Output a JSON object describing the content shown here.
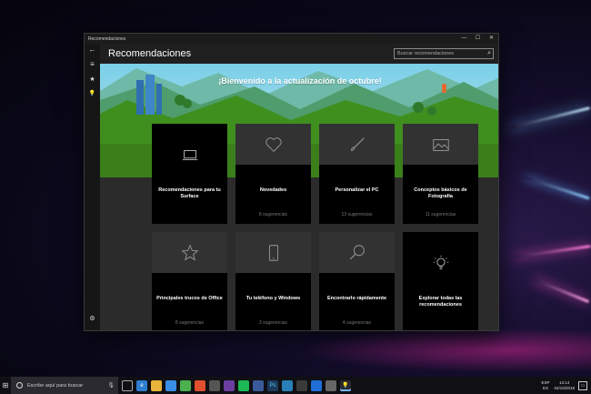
{
  "window": {
    "titlebar_title": "Recomendaciones",
    "controls": {
      "minimize": "—",
      "maximize": "☐",
      "close": "✕"
    }
  },
  "nav": {
    "back_icon": "←",
    "menu_icon": "≡",
    "favorites_icon": "★",
    "tips_icon": "💡",
    "settings_icon": "⚙"
  },
  "header": {
    "page_title": "Recomendaciones",
    "search_placeholder": "Buscar recomendaciones"
  },
  "banner": {
    "welcome_text": "¡Bienvenido a la actualización de octubre!"
  },
  "tiles": [
    {
      "title": "Recomendaciones para tu Surface",
      "count": "",
      "icon": "laptop-icon",
      "featured": true
    },
    {
      "title": "Novedades",
      "count": "8 sugerencias",
      "icon": "heart-icon"
    },
    {
      "title": "Personalizar el PC",
      "count": "13 sugerencias",
      "icon": "brush-icon"
    },
    {
      "title": "Conceptos básicos de Fotografía",
      "count": "11 sugerencias",
      "icon": "photo-icon"
    },
    {
      "title": "Principales trucos de Office",
      "count": "8 sugerencias",
      "icon": "star-icon"
    },
    {
      "title": "Tu teléfono y Windows",
      "count": "3 sugerencias",
      "icon": "phone-icon"
    },
    {
      "title": "Encontrarlo rápidamente",
      "count": "4 sugerencias",
      "icon": "search-icon"
    },
    {
      "title": "Explorar todas las recomendaciones",
      "count": "",
      "icon": "lightbulb-icon",
      "featured": true
    }
  ],
  "taskbar": {
    "search_placeholder": "Escribe aquí para buscar",
    "lang_line1": "ESP",
    "lang_line2": "ES",
    "time": "14:14",
    "date": "04/10/2018"
  },
  "colors": {
    "accent": "#7ab8ff",
    "window_bg": "#1f1f1f",
    "tile_bg": "#000000",
    "tile_top": "#323232",
    "grass": "#3f8f1f"
  }
}
